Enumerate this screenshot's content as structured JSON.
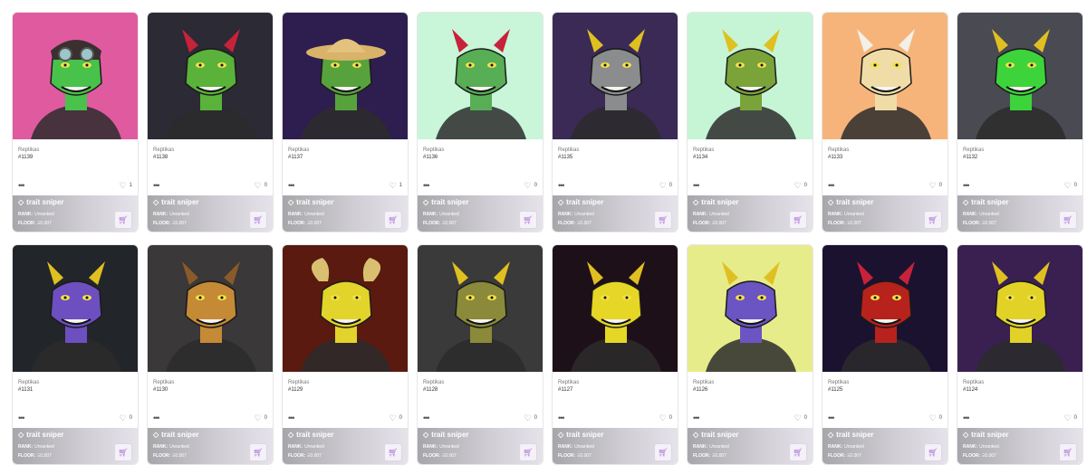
{
  "items": [
    {
      "collection": "Reptikas",
      "id": "#1139",
      "likes": "1",
      "rank_label": "RANK:",
      "rank": "Unranked",
      "floor_label": "FLOOR:",
      "floor": "Ξ0.007",
      "bg": "#e05aa0",
      "skin": "#48c24a",
      "hat": "aviator"
    },
    {
      "collection": "Reptikas",
      "id": "#1138",
      "likes": "0",
      "rank_label": "RANK:",
      "rank": "Unranked",
      "floor_label": "FLOOR:",
      "floor": "Ξ0.007",
      "bg": "#2b2a35",
      "skin": "#5ab23a",
      "hat": "horns-red"
    },
    {
      "collection": "Reptikas",
      "id": "#1137",
      "likes": "1",
      "rank_label": "RANK:",
      "rank": "Unranked",
      "floor_label": "FLOOR:",
      "floor": "Ξ0.007",
      "bg": "#2e1e4f",
      "skin": "#58a23d",
      "hat": "straw"
    },
    {
      "collection": "Reptikas",
      "id": "#1136",
      "likes": "0",
      "rank_label": "RANK:",
      "rank": "Unranked",
      "floor_label": "FLOOR:",
      "floor": "Ξ0.007",
      "bg": "#c9f5d9",
      "skin": "#58ae55",
      "hat": "horns-red"
    },
    {
      "collection": "Reptikas",
      "id": "#1135",
      "likes": "0",
      "rank_label": "RANK:",
      "rank": "Unranked",
      "floor_label": "FLOOR:",
      "floor": "Ξ0.007",
      "bg": "#3a2a55",
      "skin": "#8a8c8e",
      "hat": "horns-yellow"
    },
    {
      "collection": "Reptikas",
      "id": "#1134",
      "likes": "0",
      "rank_label": "RANK:",
      "rank": "Unranked",
      "floor_label": "FLOOR:",
      "floor": "Ξ0.007",
      "bg": "#c6f5d5",
      "skin": "#7aa33a",
      "hat": "horns-yellow"
    },
    {
      "collection": "Reptikas",
      "id": "#1133",
      "likes": "0",
      "rank_label": "RANK:",
      "rank": "Unranked",
      "floor_label": "FLOOR:",
      "floor": "Ξ0.007",
      "bg": "#f7b47a",
      "skin": "#f0dca6",
      "hat": "horns-white"
    },
    {
      "collection": "Reptikas",
      "id": "#1132",
      "likes": "0",
      "rank_label": "RANK:",
      "rank": "Unranked",
      "floor_label": "FLOOR:",
      "floor": "Ξ0.007",
      "bg": "#4a4a52",
      "skin": "#3cd43a",
      "hat": "horns-yellow"
    },
    {
      "collection": "Reptikas",
      "id": "#1131",
      "likes": "0",
      "rank_label": "RANK:",
      "rank": "Unranked",
      "floor_label": "FLOOR:",
      "floor": "Ξ0.007",
      "bg": "#22262a",
      "skin": "#6d4fc0",
      "hat": "horns-yellow"
    },
    {
      "collection": "Reptikas",
      "id": "#1130",
      "likes": "0",
      "rank_label": "RANK:",
      "rank": "Unranked",
      "floor_label": "FLOOR:",
      "floor": "Ξ0.007",
      "bg": "#3a3838",
      "skin": "#c58a35",
      "hat": "horns-brown"
    },
    {
      "collection": "Reptikas",
      "id": "#1129",
      "likes": "0",
      "rank_label": "RANK:",
      "rank": "Unranked",
      "floor_label": "FLOOR:",
      "floor": "Ξ0.007",
      "bg": "#5a1a10",
      "skin": "#e2d42a",
      "hat": "ram"
    },
    {
      "collection": "Reptikas",
      "id": "#1128",
      "likes": "0",
      "rank_label": "RANK:",
      "rank": "Unranked",
      "floor_label": "FLOOR:",
      "floor": "Ξ0.007",
      "bg": "#3a3a3a",
      "skin": "#8a8a3a",
      "hat": "horns-yellow"
    },
    {
      "collection": "Reptikas",
      "id": "#1127",
      "likes": "0",
      "rank_label": "RANK:",
      "rank": "Unranked",
      "floor_label": "FLOOR:",
      "floor": "Ξ0.007",
      "bg": "#1e1018",
      "skin": "#e6d626",
      "hat": "horns-yellow"
    },
    {
      "collection": "Reptikas",
      "id": "#1126",
      "likes": "0",
      "rank_label": "RANK:",
      "rank": "Unranked",
      "floor_label": "FLOOR:",
      "floor": "Ξ0.007",
      "bg": "#e7ec8a",
      "skin": "#6a55c2",
      "hat": "horns-yellow"
    },
    {
      "collection": "Reptikas",
      "id": "#1125",
      "likes": "0",
      "rank_label": "RANK:",
      "rank": "Unranked",
      "floor_label": "FLOOR:",
      "floor": "Ξ0.007",
      "bg": "#1b1230",
      "skin": "#b8221c",
      "hat": "horns-red"
    },
    {
      "collection": "Reptikas",
      "id": "#1124",
      "likes": "0",
      "rank_label": "RANK:",
      "rank": "Unranked",
      "floor_label": "FLOOR:",
      "floor": "Ξ0.007",
      "bg": "#3a2050",
      "skin": "#e2d228",
      "hat": "horns-yellow"
    }
  ],
  "trait_sniper_label": "trait sniper",
  "more_label": "•••",
  "heart_icon": "heart-icon",
  "cart_icon": "cart-icon",
  "gem_icon": "diamond-icon"
}
